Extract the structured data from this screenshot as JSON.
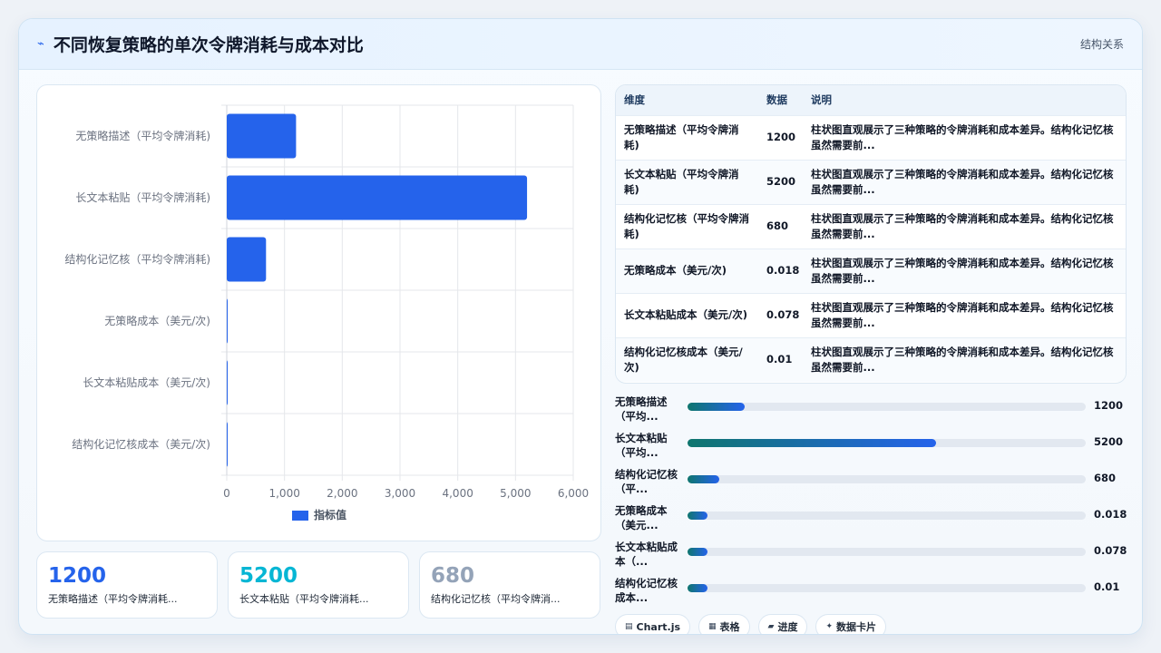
{
  "header": {
    "title": "不同恢复策略的单次令牌消耗与成本对比",
    "right_label": "结构关系"
  },
  "chart_data": {
    "type": "bar",
    "orientation": "horizontal",
    "categories": [
      "无策略描述（平均令牌消耗)",
      "长文本粘贴（平均令牌消耗)",
      "结构化记忆核（平均令牌消耗)",
      "无策略成本（美元/次)",
      "长文本粘贴成本（美元/次)",
      "结构化记忆核成本（美元/次)"
    ],
    "series": [
      {
        "name": "指标值",
        "values": [
          1200,
          5200,
          680,
          0.018,
          0.078,
          0.01
        ]
      }
    ],
    "xlim": [
      0,
      6000
    ],
    "xticks": [
      "0",
      "1,000",
      "2,000",
      "3,000",
      "4,000",
      "5,000",
      "6,000"
    ],
    "legend": "bottom",
    "grid": true,
    "bar_color": "#2563eb"
  },
  "stats": [
    {
      "value": "1200",
      "label": "无策略描述（平均令牌消耗...",
      "color": "#2563eb"
    },
    {
      "value": "5200",
      "label": "长文本粘贴（平均令牌消耗...",
      "color": "#06b6d4"
    },
    {
      "value": "680",
      "label": "结构化记忆核（平均令牌消...",
      "color": "#94a3b8"
    }
  ],
  "table": {
    "headers": [
      "维度",
      "数据",
      "说明"
    ],
    "rows": [
      {
        "dim": "无策略描述（平均令牌消耗)",
        "value": "1200",
        "desc": "柱状图直观展示了三种策略的令牌消耗和成本差异。结构化记忆核虽然需要前..."
      },
      {
        "dim": "长文本粘贴（平均令牌消耗)",
        "value": "5200",
        "desc": "柱状图直观展示了三种策略的令牌消耗和成本差异。结构化记忆核虽然需要前..."
      },
      {
        "dim": "结构化记忆核（平均令牌消耗)",
        "value": "680",
        "desc": "柱状图直观展示了三种策略的令牌消耗和成本差异。结构化记忆核虽然需要前..."
      },
      {
        "dim": "无策略成本（美元/次)",
        "value": "0.018",
        "desc": "柱状图直观展示了三种策略的令牌消耗和成本差异。结构化记忆核虽然需要前..."
      },
      {
        "dim": "长文本粘贴成本（美元/次)",
        "value": "0.078",
        "desc": "柱状图直观展示了三种策略的令牌消耗和成本差异。结构化记忆核虽然需要前..."
      },
      {
        "dim": "结构化记忆核成本（美元/次)",
        "value": "0.01",
        "desc": "柱状图直观展示了三种策略的令牌消耗和成本差异。结构化记忆核虽然需要前..."
      }
    ]
  },
  "progress": [
    {
      "label": "无策略描述（平均...",
      "value": "1200",
      "fraction": 0.144
    },
    {
      "label": "长文本粘贴（平均...",
      "value": "5200",
      "fraction": 0.625
    },
    {
      "label": "结构化记忆核（平...",
      "value": "680",
      "fraction": 0.08
    },
    {
      "label": "无策略成本（美元...",
      "value": "0.018",
      "fraction": 0.05
    },
    {
      "label": "长文本粘贴成本（...",
      "value": "0.078",
      "fraction": 0.05
    },
    {
      "label": "结构化记忆核成本...",
      "value": "0.01",
      "fraction": 0.05
    }
  ],
  "chips": [
    {
      "icon": "chart-icon",
      "glyph": "▤",
      "label": "Chart.js"
    },
    {
      "icon": "table-icon",
      "glyph": "▦",
      "label": "表格"
    },
    {
      "icon": "progress-icon",
      "glyph": "▰",
      "label": "进度"
    },
    {
      "icon": "sparkle-icon",
      "glyph": "✦",
      "label": "数据卡片"
    }
  ]
}
